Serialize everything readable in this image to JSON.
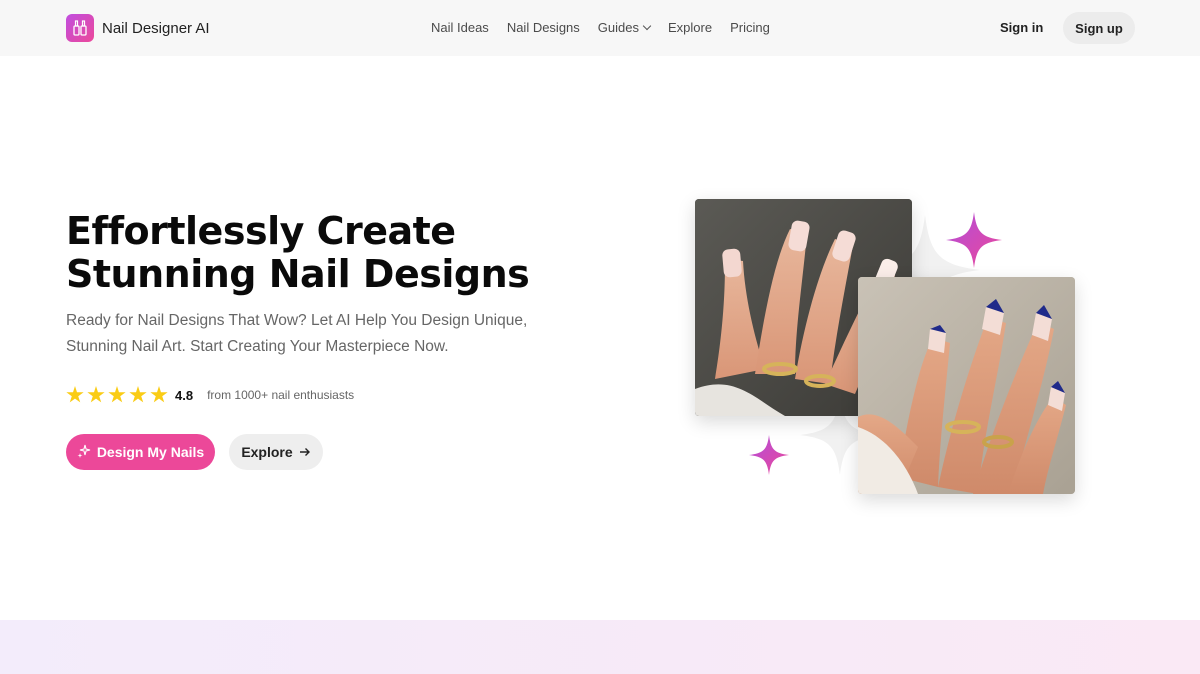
{
  "header": {
    "brand": "Nail Designer AI",
    "nav": [
      {
        "label": "Nail Ideas"
      },
      {
        "label": "Nail Designs"
      },
      {
        "label": "Guides"
      },
      {
        "label": "Explore"
      },
      {
        "label": "Pricing"
      }
    ],
    "signin_label": "Sign in",
    "signup_label": "Sign up"
  },
  "hero": {
    "title_line1": "Effortlessly Create",
    "title_line2": "Stunning Nail Designs",
    "subtitle": "Ready for Nail Designs That Wow? Let AI Help You Design Unique, Stunning Nail Art. Start Creating Your Masterpiece Now.",
    "rating": {
      "stars": 5,
      "score": "4.8",
      "text": "from 1000+ nail enthusiasts"
    },
    "primary_button": "Design My Nails",
    "secondary_button": "Explore"
  },
  "colors": {
    "accent": "#ec4899",
    "sparkle": "#c04ee0",
    "star": "#facc15"
  }
}
